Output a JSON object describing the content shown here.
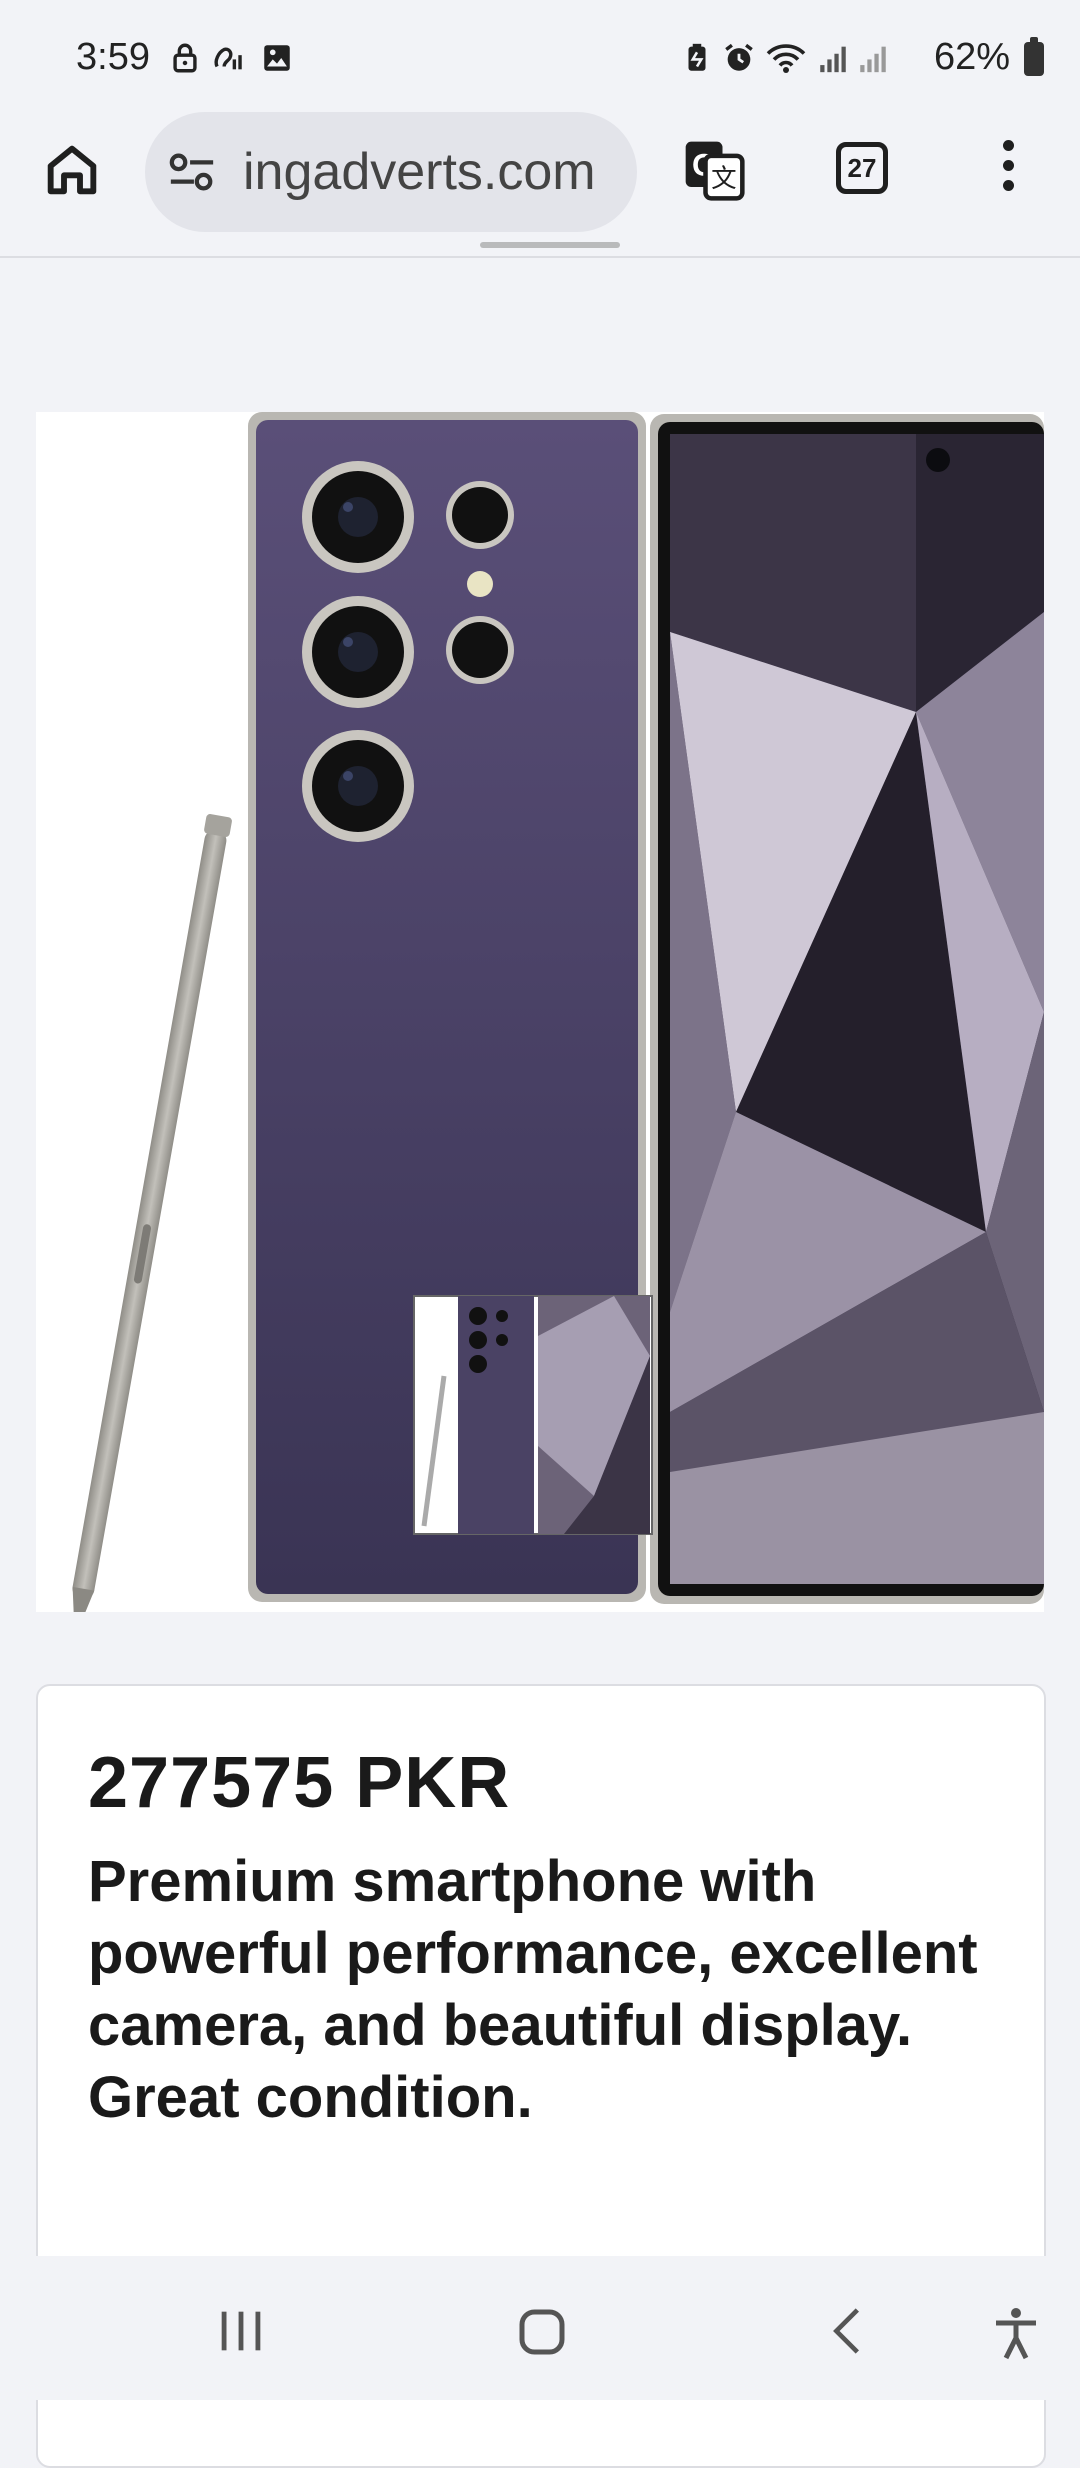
{
  "status_bar": {
    "time": "3:59",
    "battery": "62%",
    "left_icons": [
      "lock-icon",
      "nfc-icon",
      "image-icon"
    ],
    "right_icons": [
      "battery-saver-icon",
      "alarm-icon",
      "wifi-icon",
      "signal-icon",
      "signal-icon"
    ]
  },
  "browser": {
    "url": "ingadverts.com",
    "tab_count": "27",
    "icons": [
      "home-icon",
      "site-settings-icon",
      "translate-icon",
      "more-vert-icon"
    ]
  },
  "listing": {
    "price": "277575 PKR",
    "description": "Premium smartphone with powerful performance, excellent camera, and beautiful display. Great condition."
  },
  "nav_bar": {
    "icons": [
      "recents-icon",
      "home-icon",
      "back-icon",
      "accessibility-icon"
    ]
  }
}
